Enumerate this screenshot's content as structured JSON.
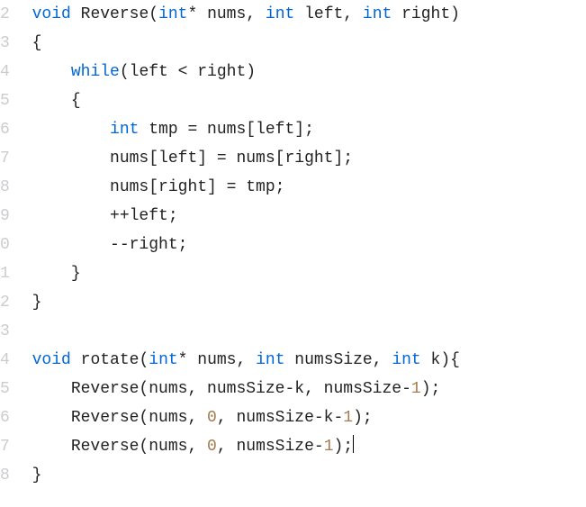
{
  "lineStart": 2,
  "lines": [
    {
      "tokens": [
        {
          "t": " ",
          "c": "txt"
        },
        {
          "t": "void",
          "c": "kw"
        },
        {
          "t": " Reverse(",
          "c": "txt"
        },
        {
          "t": "int",
          "c": "kw"
        },
        {
          "t": "* nums, ",
          "c": "txt"
        },
        {
          "t": "int",
          "c": "kw"
        },
        {
          "t": " left, ",
          "c": "txt"
        },
        {
          "t": "int",
          "c": "kw"
        },
        {
          "t": " right)",
          "c": "txt"
        }
      ]
    },
    {
      "tokens": [
        {
          "t": " {",
          "c": "txt"
        }
      ]
    },
    {
      "tokens": [
        {
          "t": "     ",
          "c": "txt"
        },
        {
          "t": "while",
          "c": "kw"
        },
        {
          "t": "(left < right)",
          "c": "txt"
        }
      ]
    },
    {
      "tokens": [
        {
          "t": "     {",
          "c": "txt"
        }
      ]
    },
    {
      "tokens": [
        {
          "t": "         ",
          "c": "txt"
        },
        {
          "t": "int",
          "c": "kw"
        },
        {
          "t": " tmp = nums[left];",
          "c": "txt"
        }
      ]
    },
    {
      "tokens": [
        {
          "t": "         nums[left] = nums[right];",
          "c": "txt"
        }
      ]
    },
    {
      "tokens": [
        {
          "t": "         nums[right] = tmp;",
          "c": "txt"
        }
      ]
    },
    {
      "tokens": [
        {
          "t": "         ++left;",
          "c": "txt"
        }
      ]
    },
    {
      "tokens": [
        {
          "t": "         --right;",
          "c": "txt"
        }
      ]
    },
    {
      "tokens": [
        {
          "t": "     }",
          "c": "txt"
        }
      ]
    },
    {
      "tokens": [
        {
          "t": " }",
          "c": "txt"
        }
      ]
    },
    {
      "tokens": [
        {
          "t": "",
          "c": "txt"
        }
      ]
    },
    {
      "tokens": [
        {
          "t": " ",
          "c": "txt"
        },
        {
          "t": "void",
          "c": "kw"
        },
        {
          "t": " rotate(",
          "c": "txt"
        },
        {
          "t": "int",
          "c": "kw"
        },
        {
          "t": "* nums, ",
          "c": "txt"
        },
        {
          "t": "int",
          "c": "kw"
        },
        {
          "t": " numsSize, ",
          "c": "txt"
        },
        {
          "t": "int",
          "c": "kw"
        },
        {
          "t": " k){",
          "c": "txt"
        }
      ]
    },
    {
      "tokens": [
        {
          "t": "     Reverse(nums, numsSize-k, numsSize-",
          "c": "txt"
        },
        {
          "t": "1",
          "c": "num"
        },
        {
          "t": ");",
          "c": "txt"
        }
      ]
    },
    {
      "tokens": [
        {
          "t": "     Reverse(nums, ",
          "c": "txt"
        },
        {
          "t": "0",
          "c": "num"
        },
        {
          "t": ", numsSize-k-",
          "c": "txt"
        },
        {
          "t": "1",
          "c": "num"
        },
        {
          "t": ");",
          "c": "txt"
        }
      ]
    },
    {
      "tokens": [
        {
          "t": "     Reverse(nums, ",
          "c": "txt"
        },
        {
          "t": "0",
          "c": "num"
        },
        {
          "t": ", numsSize-",
          "c": "txt"
        },
        {
          "t": "1",
          "c": "num"
        },
        {
          "t": ");",
          "c": "txt"
        }
      ],
      "cursorAfter": true
    },
    {
      "tokens": [
        {
          "t": " }",
          "c": "txt"
        }
      ]
    }
  ]
}
